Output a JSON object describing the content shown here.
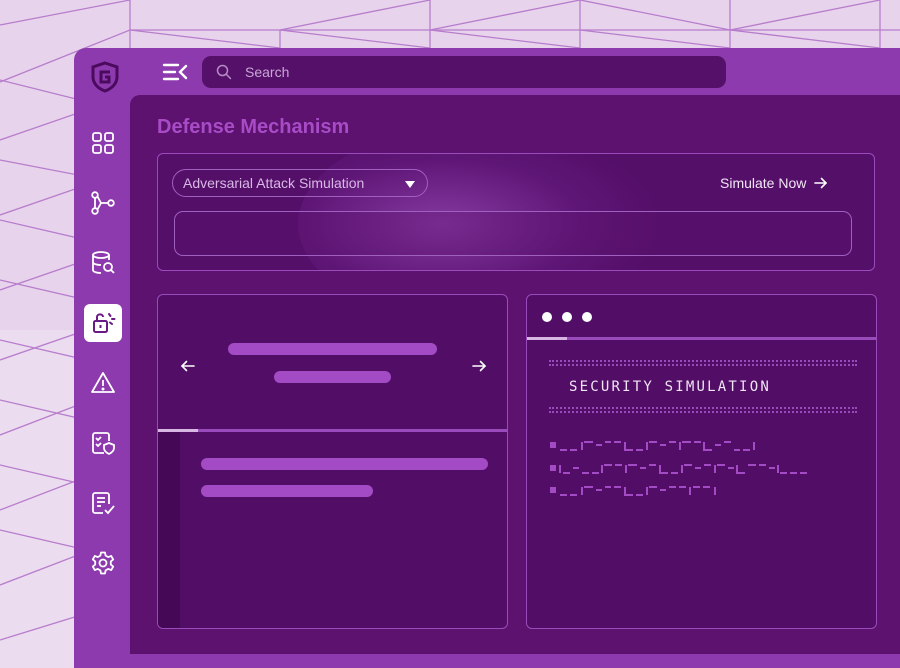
{
  "search": {
    "placeholder": "Search"
  },
  "sidebar": {
    "items": [
      {
        "icon": "dashboard-grid-icon",
        "active": false
      },
      {
        "icon": "workflow-nodes-icon",
        "active": false
      },
      {
        "icon": "database-search-icon",
        "active": false
      },
      {
        "icon": "unlocked-padlock-icon",
        "active": true
      },
      {
        "icon": "warning-triangle-icon",
        "active": false
      },
      {
        "icon": "shield-checklist-icon",
        "active": false
      },
      {
        "icon": "document-check-icon",
        "active": false
      },
      {
        "icon": "gear-icon",
        "active": false
      }
    ]
  },
  "main": {
    "title": "Defense Mechanism",
    "simulation": {
      "selected_attack": "Adversarial Attack Simulation",
      "simulate_label": "Simulate Now"
    },
    "terminal": {
      "title": "SECURITY SIMULATION"
    }
  },
  "colors": {
    "accent": "#a84bc7",
    "panel": "#5c126e",
    "frame": "#8d3aae",
    "border": "#9a4bbb",
    "active_item": "#ffffff"
  }
}
